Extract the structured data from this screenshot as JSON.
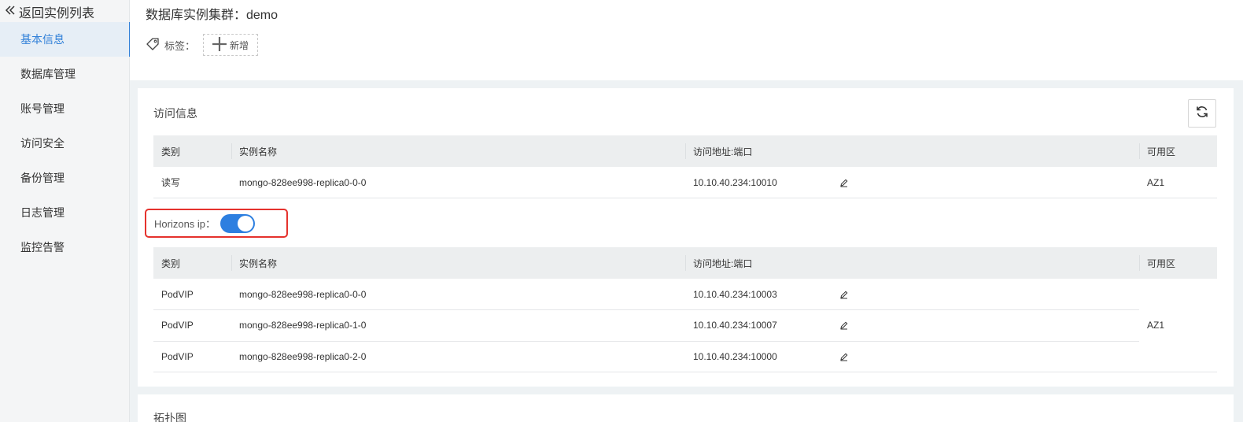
{
  "sidebar": {
    "back_label": "返回实例列表",
    "items": [
      {
        "label": "基本信息",
        "active": true
      },
      {
        "label": "数据库管理"
      },
      {
        "label": "账号管理"
      },
      {
        "label": "访问安全"
      },
      {
        "label": "备份管理"
      },
      {
        "label": "日志管理"
      },
      {
        "label": "监控告警"
      }
    ]
  },
  "header": {
    "cluster_title": "数据库实例集群：demo",
    "tags_label": "标签：",
    "add_tag_label": "新增"
  },
  "access": {
    "title": "访问信息",
    "columns": [
      "类别",
      "实例名称",
      "访问地址:端口",
      "可用区"
    ],
    "rows": [
      {
        "type": "读写",
        "name": "mongo-828ee998-replica0-0-0",
        "addr": "10.10.40.234:10010",
        "az": "AZ1"
      }
    ],
    "horizons_label": "Horizons ip：",
    "horizons_on": true,
    "horizon_columns": [
      "类别",
      "实例名称",
      "访问地址:端口",
      "可用区"
    ],
    "horizon_rows": [
      {
        "type": "PodVIP",
        "name": "mongo-828ee998-replica0-0-0",
        "addr": "10.10.40.234:10003"
      },
      {
        "type": "PodVIP",
        "name": "mongo-828ee998-replica0-1-0",
        "addr": "10.10.40.234:10007"
      },
      {
        "type": "PodVIP",
        "name": "mongo-828ee998-replica0-2-0",
        "addr": "10.10.40.234:10000"
      }
    ],
    "horizon_az": "AZ1"
  },
  "topology": {
    "title": "拓扑图"
  },
  "colors": {
    "accent": "#2f7fd8",
    "highlight_border": "#e5322d",
    "toggle_on": "#2d7fe0"
  }
}
